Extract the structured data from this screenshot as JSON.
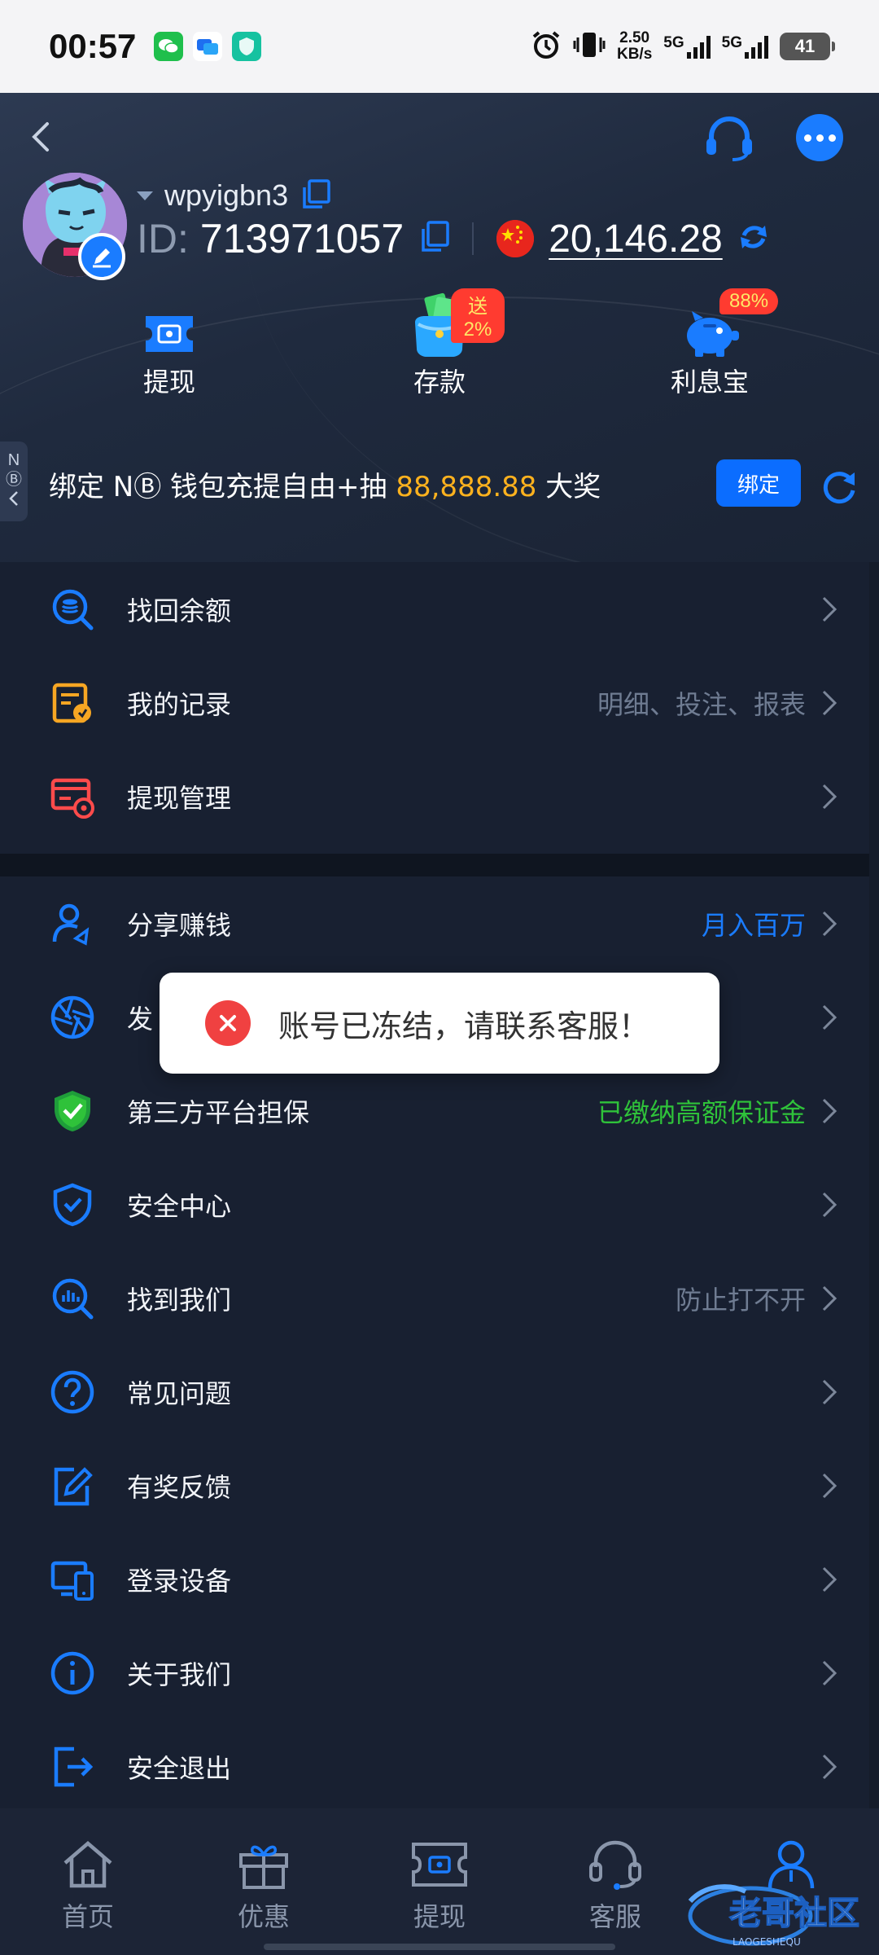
{
  "status_bar": {
    "time": "00:57",
    "net_speed_value": "2.50",
    "net_speed_unit": "KB/s",
    "sim1": "5G",
    "sim2": "5G",
    "battery": "41"
  },
  "header": {
    "username": "wpyigbn3",
    "id_label": "ID:",
    "id_value": "713971057",
    "balance": "20,146.28"
  },
  "quick_actions": [
    {
      "label": "提现",
      "badge": ""
    },
    {
      "label": "存款",
      "badge": "送2%"
    },
    {
      "label": "利息宝",
      "badge": "88%"
    }
  ],
  "promo": {
    "tab_n": "N",
    "tab_b": "Ⓑ",
    "text_before": "绑定 N",
    "text_b": "Ⓑ",
    "text_mid": " 钱包充提自由+抽 ",
    "amount": "88,888.88",
    "text_after": " 大奖",
    "bind_label": "绑定"
  },
  "menu_group1": [
    {
      "label": "找回余额",
      "extra": "",
      "icon": "coin-search-icon"
    },
    {
      "label": "我的记录",
      "extra": "明细、投注、报表",
      "icon": "record-icon"
    },
    {
      "label": "提现管理",
      "extra": "",
      "icon": "card-gear-icon"
    }
  ],
  "menu_group2": [
    {
      "label": "分享赚钱",
      "extra": "月入百万",
      "icon": "share-user-icon"
    },
    {
      "label": "发",
      "extra": "",
      "icon": "aperture-icon"
    },
    {
      "label": "第三方平台担保",
      "extra": "已缴纳高额保证金",
      "icon": "shield-check-icon"
    },
    {
      "label": "安全中心",
      "extra": "",
      "icon": "security-shield-icon"
    },
    {
      "label": "找到我们",
      "extra": "防止打不开",
      "icon": "search-doc-icon"
    },
    {
      "label": "常见问题",
      "extra": "",
      "icon": "question-icon"
    },
    {
      "label": "有奖反馈",
      "extra": "",
      "icon": "edit-icon"
    },
    {
      "label": "登录设备",
      "extra": "",
      "icon": "devices-icon"
    },
    {
      "label": "关于我们",
      "extra": "",
      "icon": "info-icon"
    },
    {
      "label": "安全退出",
      "extra": "",
      "icon": "logout-icon"
    }
  ],
  "toast": {
    "message": "账号已冻结，请联系客服！"
  },
  "bottom_nav": [
    {
      "label": "首页"
    },
    {
      "label": "优惠"
    },
    {
      "label": "提现"
    },
    {
      "label": "客服"
    },
    {
      "label": ""
    }
  ],
  "watermark": {
    "text": "老哥社区",
    "sub": "LAOGESHEQU"
  },
  "colors": {
    "accent": "#1a7cff",
    "orange": "#ffb21e",
    "green": "#2fc23a",
    "extra_gray": "#6f7c92",
    "background": "#182031"
  }
}
